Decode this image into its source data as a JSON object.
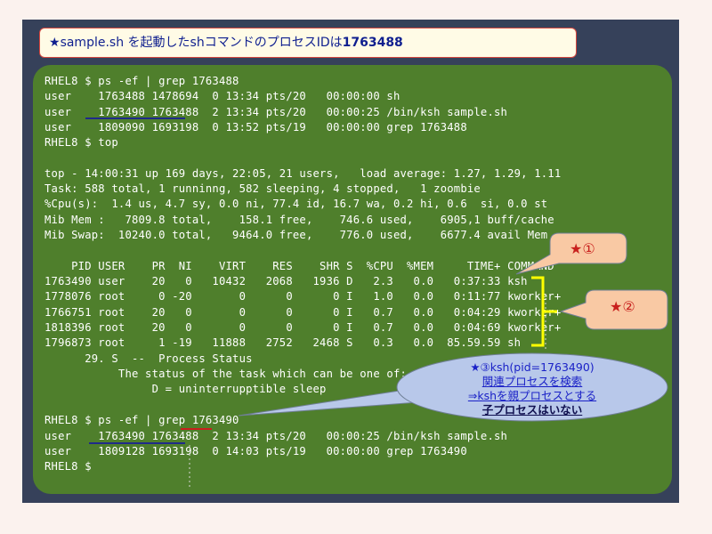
{
  "title_banner": {
    "star": "★",
    "text": "sample.sh を起動したshコマンドのプロセスIDは",
    "pid": "1763488"
  },
  "terminal": {
    "lines": [
      "RHEL8 $ ps -ef | grep 1763488",
      "user    1763488 1478694  0 13:34 pts/20   00:00:00 sh",
      "user    1763490 1763488  2 13:34 pts/20   00:00:25 /bin/ksh sample.sh",
      "user    1809090 1693198  0 13:52 pts/19   00:00:00 grep 1763488",
      "RHEL8 $ top",
      "",
      "top - 14:00:31 up 169 days, 22:05, 21 users,   load average: 1.27, 1.29, 1.11",
      "Task: 588 total, 1 runninng, 582 sleeping, 4 stopped,   1 zoombie",
      "%Cpu(s):  1.4 us, 4.7 sy, 0.0 ni, 77.4 id, 16.7 wa, 0.2 hi, 0.6  si, 0.0 st",
      "Mib Mem :   7809.8 total,    158.1 free,    746.6 used,    6905,1 buff/cache",
      "Mib Swap:  10240.0 total,   9464.0 free,    776.0 used,    6677.4 avail Mem",
      "",
      "    PID USER    PR  NI    VIRT    RES    SHR S  %CPU  %MEM     TIME+ COMMAND",
      "1763490 user    20   0   10432   2068   1936 D   2.3   0.0   0:37:33 ksh",
      "1778076 root     0 -20       0      0      0 I   1.0   0.0   0:11:77 kworker+",
      "1766751 root    20   0       0      0      0 I   0.7   0.0   0:04:29 kworker+",
      "1818396 root    20   0       0      0      0 I   0.7   0.0   0:04:69 kworker+",
      "1796873 root     1 -19   11888   2752   2468 S   0.3   0.0  85.59.59 sh",
      "      29. S  --  Process Status",
      "           The status of the task which can be one of:",
      "                D = uninterrupptible sleep",
      "",
      "RHEL8 $ ps -ef | grep 1763490",
      "user    1763490 1763488  2 13:34 pts/20   00:00:25 /bin/ksh sample.sh",
      "user    1809128 1693198  0 14:03 pts/19   00:00:00 grep 1763490",
      "RHEL8 $"
    ]
  },
  "callouts": {
    "one": "★①",
    "two": "★②",
    "three": {
      "line1": "★③ksh(pid=1763490)",
      "line2": "関連プロセスを検索",
      "line3": "⇒kshを親プロセスとする",
      "line4": "子プロセスはいない"
    }
  },
  "colors": {
    "terminal_bg": "#4f7f2c",
    "frame_bg": "#36415a",
    "callout_fill": "#f9c9a4",
    "callout_text": "#c8201d",
    "ellipse_fill": "#b8c8ea",
    "bracket": "#ffff00"
  }
}
